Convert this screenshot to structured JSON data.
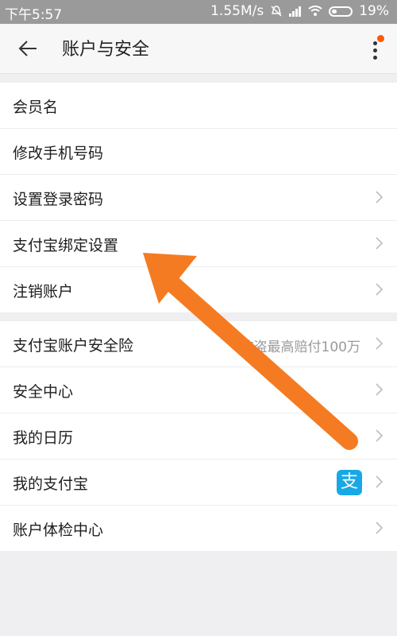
{
  "status_bar": {
    "time": "下午5:57",
    "speed": "1.55M/s",
    "battery": "19%"
  },
  "header": {
    "title": "账户与安全",
    "back_icon": "back-arrow-icon",
    "more_icon": "more-vertical-icon"
  },
  "section1": {
    "items": [
      {
        "label": "会员名"
      },
      {
        "label": "修改手机号码"
      },
      {
        "label": "设置登录密码"
      },
      {
        "label": "支付宝绑定设置"
      },
      {
        "label": "注销账户"
      }
    ]
  },
  "section2": {
    "items": [
      {
        "label": "支付宝账户安全险",
        "value": "被盗最高赔付100万"
      },
      {
        "label": "安全中心"
      },
      {
        "label": "我的日历"
      },
      {
        "label": "我的支付宝",
        "icon_text": "支"
      },
      {
        "label": "账户体检中心"
      }
    ]
  },
  "colors": {
    "accent": "#ff5a00",
    "arrow": "#f47b22",
    "alipay": "#19a8e6"
  }
}
